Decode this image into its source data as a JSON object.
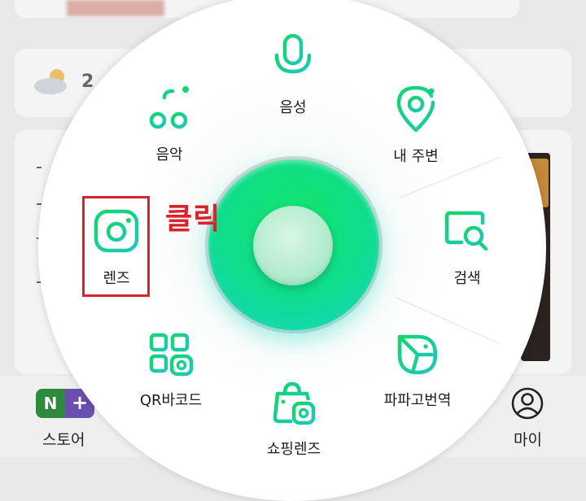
{
  "background": {
    "weather_temp": "2",
    "bottom_nav": {
      "store_label": "스토어",
      "store_icon_letter": "N",
      "store_icon_plus": "+",
      "my_label": "마이"
    }
  },
  "menu": {
    "items": [
      {
        "label": "음성",
        "icon": "microphone-icon"
      },
      {
        "label": "음악",
        "icon": "music-note-icon"
      },
      {
        "label": "내 주변",
        "icon": "location-pin-icon"
      },
      {
        "label": "렌즈",
        "icon": "camera-lens-icon"
      },
      {
        "label": "검색",
        "icon": "search-icon"
      },
      {
        "label": "QR바코드",
        "icon": "qr-barcode-icon"
      },
      {
        "label": "파파고번역",
        "icon": "papago-icon"
      },
      {
        "label": "쇼핑렌즈",
        "icon": "shopping-lens-icon"
      }
    ],
    "annotation": "클릭",
    "accent_color": "#13d58c",
    "highlight_color": "#d8232a"
  }
}
